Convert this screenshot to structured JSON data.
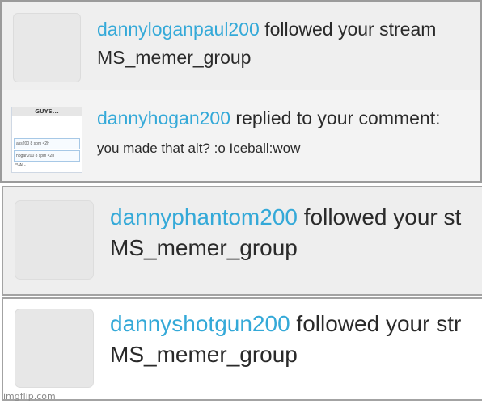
{
  "notifications": [
    {
      "username": "dannyloganpaul200",
      "action": " followed your stream",
      "detail": "MS_memer_group"
    },
    {
      "username": "dannyhogan200",
      "action": " replied to your comment:",
      "detail": "you made that alt? :o Iceball:wow",
      "thumbnail": {
        "title": "GUYS...",
        "line1": "ass200  8 spm <2h",
        "line2": "hogan200  8 spm <2h",
        "line3": "*VAL-"
      }
    },
    {
      "username": "dannyphantom200",
      "action": " followed your st",
      "detail": "MS_memer_group"
    },
    {
      "username": "dannyshotgun200",
      "action": " followed your str",
      "detail": "MS_memer_group"
    }
  ],
  "watermark": "imgflip.com"
}
